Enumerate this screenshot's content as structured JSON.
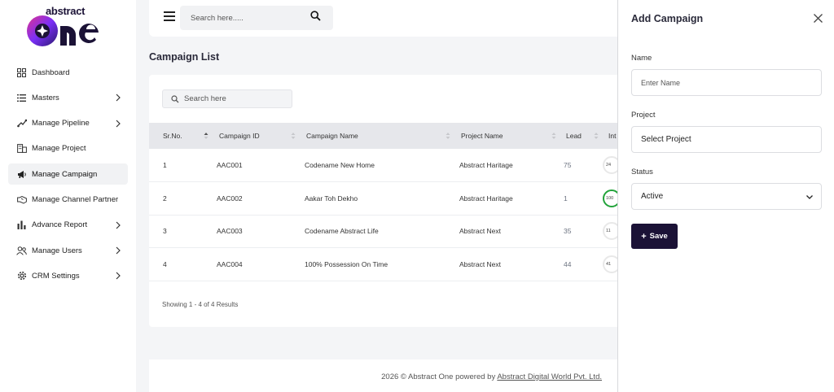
{
  "brand": {
    "small_text": "abstract",
    "large_text": "one"
  },
  "sidebar": {
    "items": [
      {
        "label": "Dashboard",
        "icon": "dashboard-grid-icon",
        "has_chevron": false,
        "active": false
      },
      {
        "label": "Masters",
        "icon": "list-icon",
        "has_chevron": true,
        "active": false
      },
      {
        "label": "Manage Pipeline",
        "icon": "pipeline-icon",
        "has_chevron": true,
        "active": false
      },
      {
        "label": "Manage Project",
        "icon": "building-icon",
        "has_chevron": false,
        "active": false
      },
      {
        "label": "Manage Campaign",
        "icon": "megaphone-icon",
        "has_chevron": false,
        "active": true
      },
      {
        "label": "Manage Channel Partner",
        "icon": "handshake-icon",
        "has_chevron": false,
        "active": false
      },
      {
        "label": "Advance Report",
        "icon": "bar-chart-icon",
        "has_chevron": true,
        "active": false
      },
      {
        "label": "Manage Users",
        "icon": "users-icon",
        "has_chevron": true,
        "active": false
      },
      {
        "label": "CRM Settings",
        "icon": "gear-icon",
        "has_chevron": true,
        "active": false
      }
    ]
  },
  "topbar": {
    "search_placeholder": "Search here....."
  },
  "page": {
    "title": "Campaign List"
  },
  "table": {
    "search_placeholder": "Search here",
    "columns": [
      "Sr.No.",
      "Campaign ID",
      "Campaign Name",
      "Project Name",
      "Lead",
      "Int"
    ],
    "rows": [
      {
        "sr": "1",
        "id": "AAC001",
        "name": "Codename New Home",
        "project": "Abstract Haritage",
        "lead": "75",
        "interest": "24"
      },
      {
        "sr": "2",
        "id": "AAC002",
        "name": "Aakar Toh Dekho",
        "project": "Abstract Haritage",
        "lead": "1",
        "interest": "100"
      },
      {
        "sr": "3",
        "id": "AAC003",
        "name": "Codename Abstract Life",
        "project": "Abstract Next",
        "lead": "35",
        "interest": "11"
      },
      {
        "sr": "4",
        "id": "AAC004",
        "name": "100% Possession On Time",
        "project": "Abstract Next",
        "lead": "44",
        "interest": "41"
      }
    ],
    "showing": "Showing 1 - 4 of 4 Results"
  },
  "footer": {
    "text": "2026 © Abstract One powered by",
    "link": "Abstract Digital World Pvt. Ltd."
  },
  "panel": {
    "title": "Add Campaign",
    "name_label": "Name",
    "name_placeholder": "Enter Name",
    "project_label": "Project",
    "project_value": "Select Project",
    "status_label": "Status",
    "status_value": "Active",
    "save_label": "Save"
  },
  "colors": {
    "brand_dark": "#1b1236",
    "accent_purple": "#7b2ff7",
    "accent_pink": "#e0338f",
    "progress_green": "#22a33a"
  }
}
